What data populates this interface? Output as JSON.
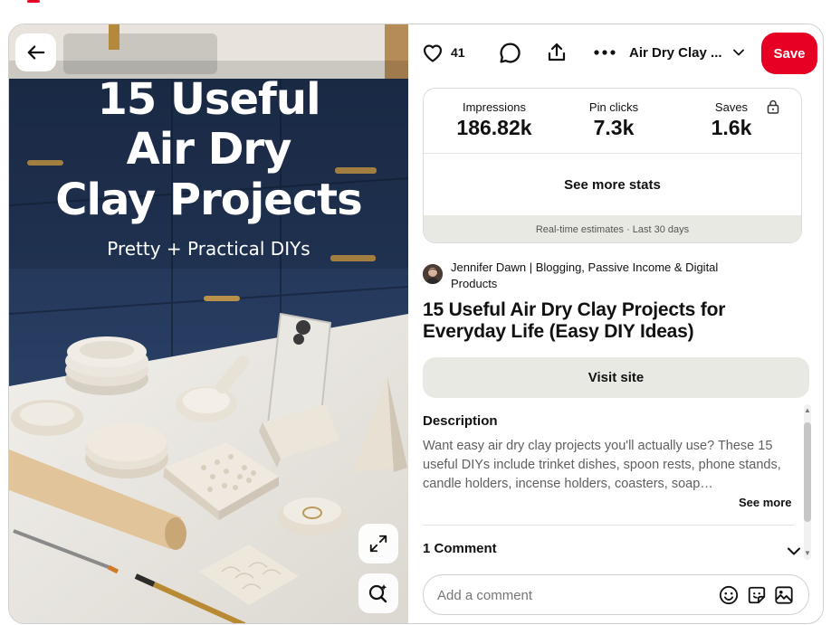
{
  "image": {
    "title_lines": [
      "15 Useful",
      "Air Dry",
      "Clay Projects"
    ],
    "subtitle": "Pretty + Practical DIYs"
  },
  "actions": {
    "like_count": "41",
    "board_name": "Air Dry Clay ...",
    "save_label": "Save"
  },
  "stats": {
    "items": [
      {
        "label": "Impressions",
        "value": "186.82k"
      },
      {
        "label": "Pin clicks",
        "value": "7.3k"
      },
      {
        "label": "Saves",
        "value": "1.6k"
      }
    ],
    "see_more_label": "See more stats",
    "footer": "Real-time estimates · Last 30 days"
  },
  "creator": {
    "name": "Jennifer Dawn | Blogging, Passive Income & Digital Products"
  },
  "pin": {
    "title": "15 Useful Air Dry Clay Projects for Everyday Life (Easy DIY Ideas)",
    "visit_label": "Visit site",
    "description_heading": "Description",
    "description": "Want easy air dry clay projects you'll actually use? These 15 useful DIYs include trinket dishes, spoon rests, phone stands, candle holders, incense holders, coasters, soap…",
    "see_more_label": "See more"
  },
  "comments": {
    "heading": "1 Comment",
    "placeholder": "Add a comment"
  },
  "colors": {
    "accent": "#e60023",
    "cabinet_navy": "#1f3352",
    "secondary_button": "#e9e9e4"
  }
}
